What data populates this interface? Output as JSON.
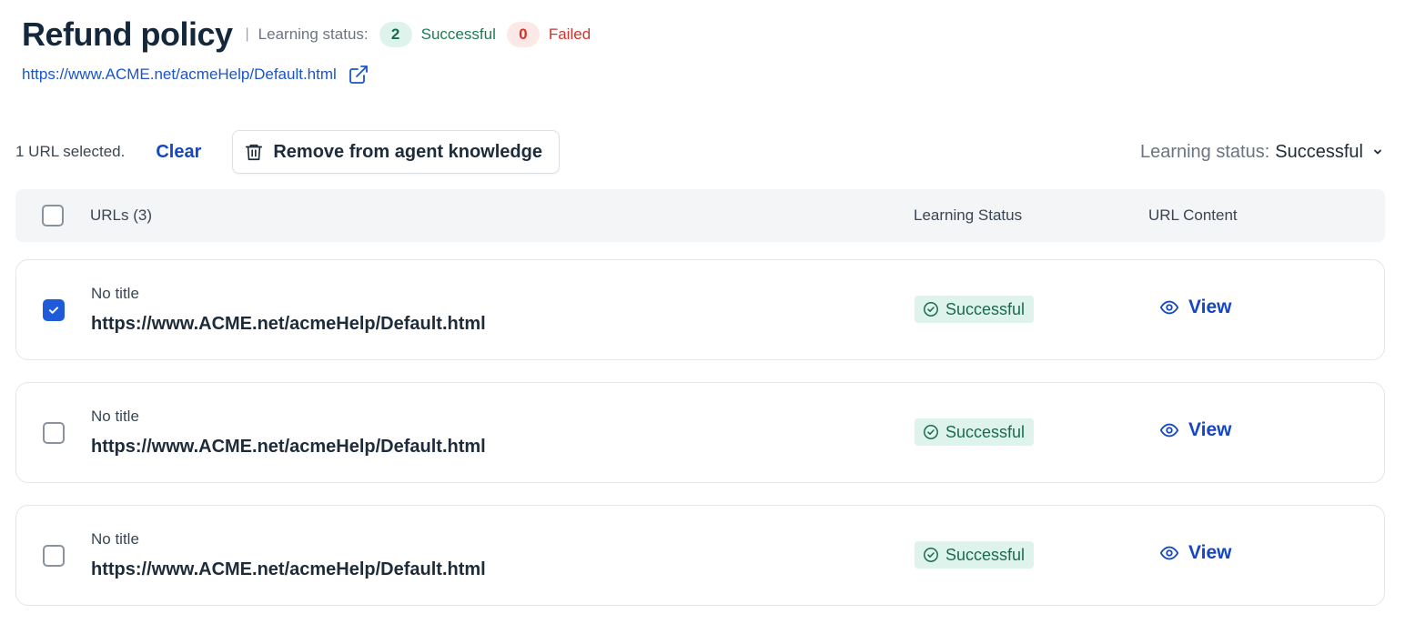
{
  "header": {
    "title": "Refund policy",
    "separator": "|",
    "learning_status_label": "Learning status:",
    "successful_count": "2",
    "successful_label": "Successful",
    "failed_count": "0",
    "failed_label": "Failed",
    "source_url": "https://www.ACME.net/acmeHelp/Default.html",
    "external_link_icon": "external-link-icon"
  },
  "toolbar": {
    "selection_text": "1 URL selected.",
    "clear_label": "Clear",
    "remove_label": "Remove from agent knowledge",
    "remove_icon": "trash-icon",
    "filter_label": "Learning status:",
    "filter_value": "Successful",
    "filter_icon": "chevron-down-icon"
  },
  "table": {
    "columns": {
      "urls": "URLs (3)",
      "learning_status": "Learning Status",
      "url_content": "URL Content"
    },
    "rows": [
      {
        "title": "No title",
        "url": "https://www.ACME.net/acmeHelp/Default.html",
        "status": "Successful",
        "action": "View",
        "checked": true
      },
      {
        "title": "No title",
        "url": "https://www.ACME.net/acmeHelp/Default.html",
        "status": "Successful",
        "action": "View",
        "checked": false
      },
      {
        "title": "No title",
        "url": "https://www.ACME.net/acmeHelp/Default.html",
        "status": "Successful",
        "action": "View",
        "checked": false
      }
    ]
  },
  "colors": {
    "primary_link": "#1447c0",
    "success_bg": "#def3ec",
    "success_text": "#1a6b4d",
    "failed_bg": "#fde8e8",
    "failed_text": "#d0342c",
    "checkbox_checked": "#1f5bd8"
  }
}
